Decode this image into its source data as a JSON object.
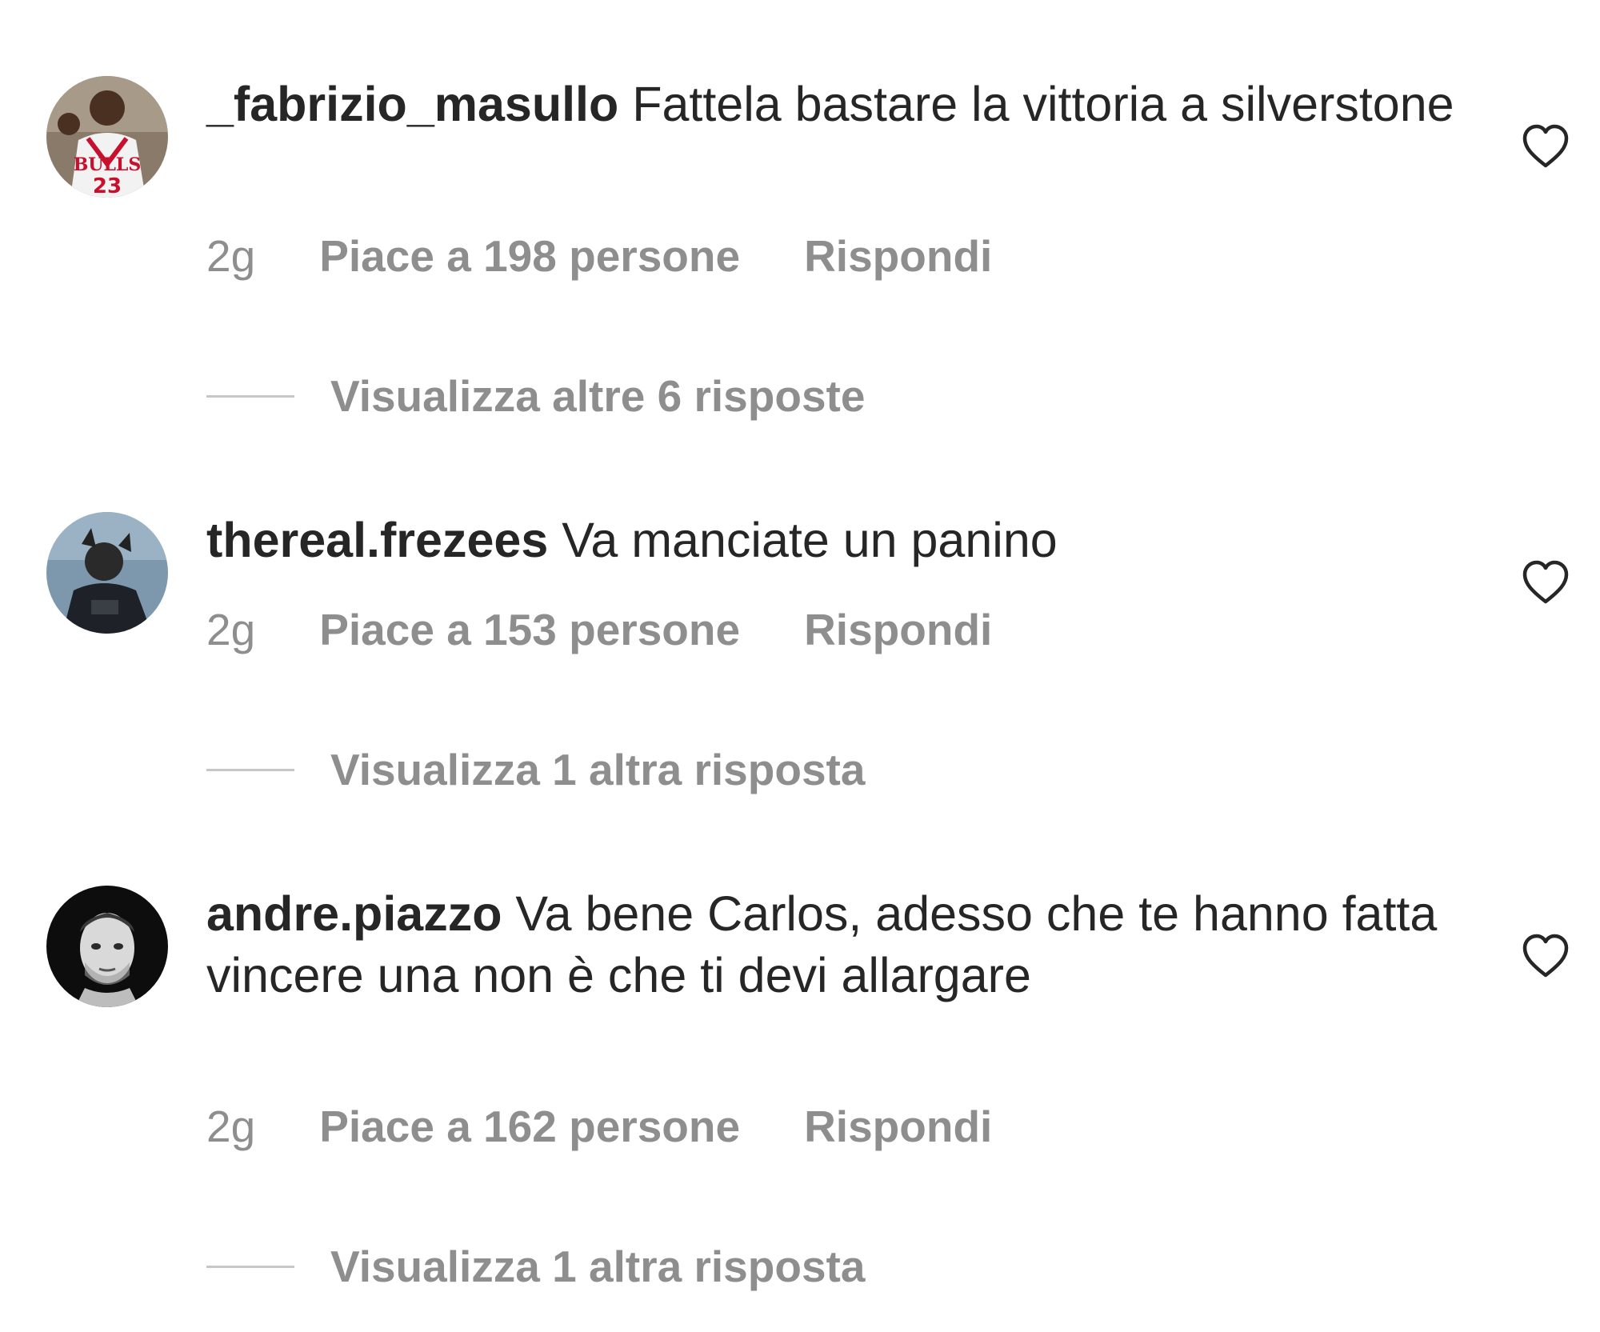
{
  "comments": [
    {
      "username": "_fabrizio_masullo",
      "text": "Fattela bastare la vittoria a silverstone",
      "time": "2g",
      "likes": "Piace a 198 persone",
      "reply": "Rispondi",
      "view_replies": "Visualizza altre 6 risposte",
      "avatar_icon": "avatar-jersey-icon"
    },
    {
      "username": "thereal.frezees",
      "text": "Va manciate un panino",
      "time": "2g",
      "likes": "Piace a 153 persone",
      "reply": "Rispondi",
      "view_replies": "Visualizza 1 altra risposta",
      "avatar_icon": "avatar-person-icon"
    },
    {
      "username": "andre.piazzo",
      "text": "Va bene Carlos, adesso che te hanno fatta vincere una non è che ti devi allargare",
      "time": "2g",
      "likes": "Piace a 162 persone",
      "reply": "Rispondi",
      "view_replies": "Visualizza 1 altra risposta",
      "avatar_icon": "avatar-face-icon"
    }
  ],
  "icons": {
    "like": "heart-icon"
  },
  "colors": {
    "text_primary": "#262626",
    "text_secondary": "#8e8e8e",
    "divider": "#c7c7c7",
    "background": "#ffffff"
  }
}
